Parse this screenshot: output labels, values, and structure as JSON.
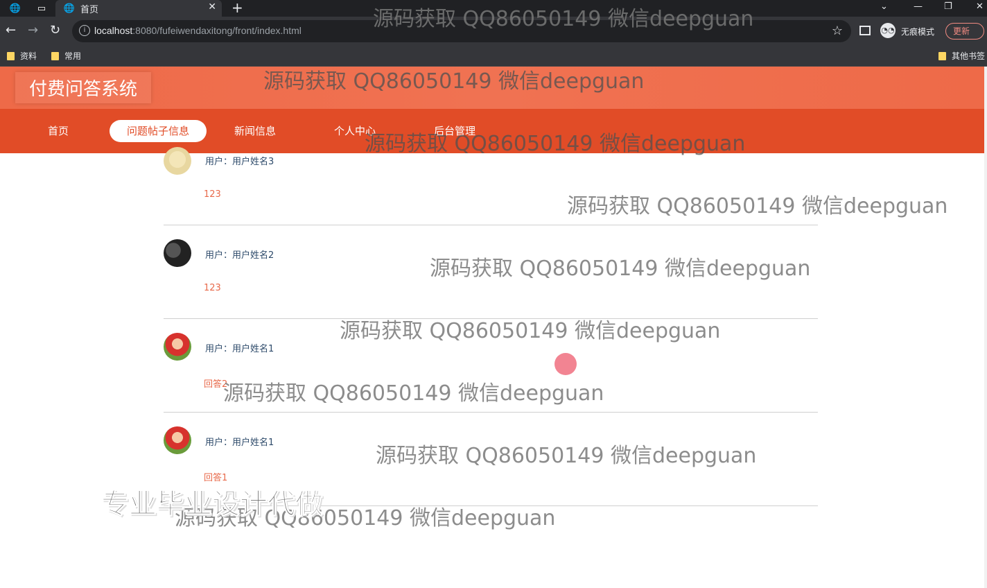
{
  "browser": {
    "tab_title": "首页",
    "url_host": "localhost",
    "url_rest": ":8080/fufeiwendaxitong/front/index.html",
    "incognito_label": "无痕模式",
    "update_label": "更新",
    "bookmarks": [
      "资料",
      "常用"
    ],
    "other_bookmarks": "其他书签"
  },
  "site": {
    "title": "付费问答系统",
    "nav": [
      "首页",
      "问题帖子信息",
      "新闻信息",
      "个人中心",
      "后台管理"
    ],
    "active_nav": "问题帖子信息"
  },
  "threads": [
    {
      "user": "用户：用户姓名3",
      "content": "123"
    },
    {
      "user": "用户：用户姓名2",
      "content": "123"
    },
    {
      "user": "用户：用户姓名1",
      "content": "回答2"
    },
    {
      "user": "用户：用户姓名1",
      "content": "回答1"
    }
  ],
  "overlay": {
    "watermark": "源码获取 QQ86050149 微信deepguan",
    "promo": "专业毕业设计代做"
  },
  "colors": {
    "header": "#ee6a48",
    "nav": "#e14c27",
    "user_text": "#2d4a6a",
    "reply_text": "#e8694a"
  }
}
